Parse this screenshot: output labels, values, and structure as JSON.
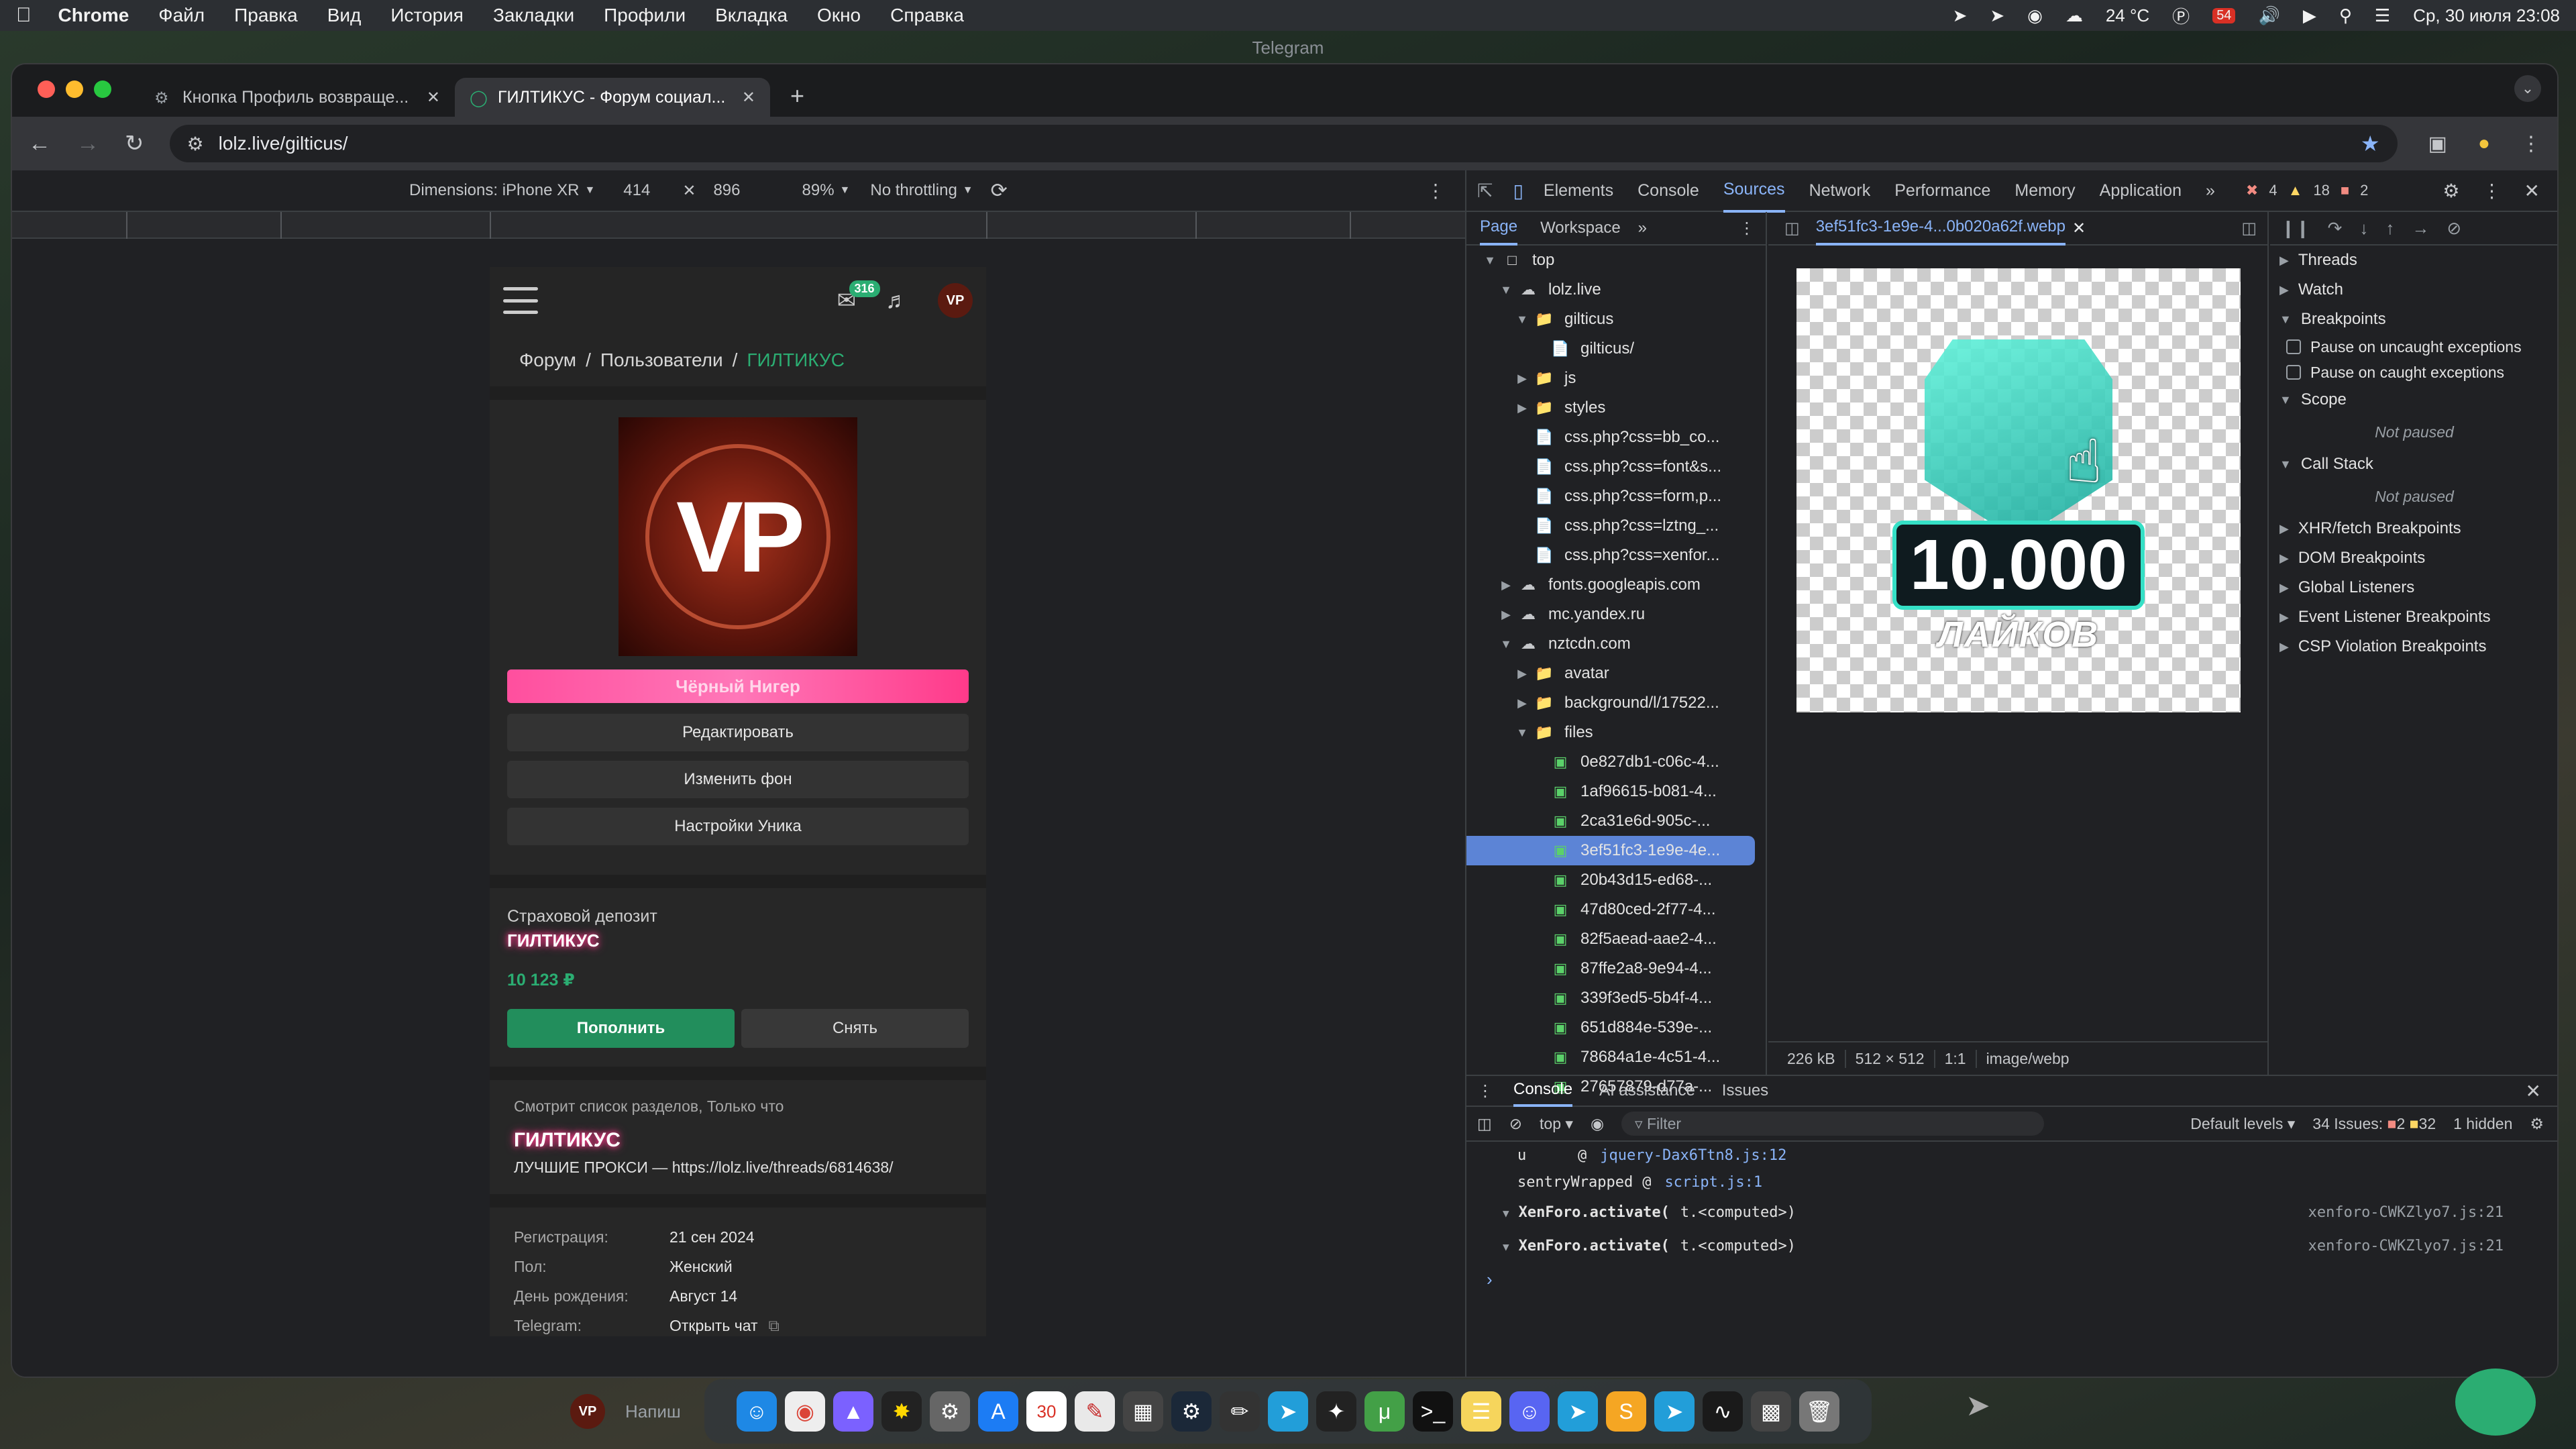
{
  "menubar": {
    "app": "Chrome",
    "menus": [
      "Файл",
      "Правка",
      "Вид",
      "История",
      "Закладки",
      "Профили",
      "Вкладка",
      "Окно",
      "Справка"
    ],
    "weather": "24 °C",
    "notif_count": "54",
    "datetime": "Ср, 30 июля  23:08"
  },
  "telegram_title": "Telegram",
  "browser": {
    "tabs": [
      {
        "label": "Кнопка Профиль возвраще..."
      },
      {
        "label": "ГИЛТИКУС - Форум социал..."
      }
    ],
    "url": "lolz.live/gilticus/"
  },
  "device_toolbar": {
    "dimensions": "Dimensions: iPhone XR",
    "width": "414",
    "height": "896",
    "zoom": "89%",
    "throttling": "No throttling"
  },
  "mobile": {
    "badge": "316",
    "avatar_small": "VP",
    "breadcrumb": [
      "Форум",
      "Пользователи",
      "ГИЛТИКУС"
    ],
    "avatar_text": "VP",
    "role": "Чёрный Нигер",
    "buttons": [
      "Редактировать",
      "Изменить фон",
      "Настройки Уника"
    ],
    "deposit_title": "Страховой депозит",
    "nick": "ГИЛТИКУС",
    "amount": "10 123 ₽",
    "deposit_btn": "Пополнить",
    "withdraw_btn": "Снять",
    "activity": "Смотрит список разделов, Только что",
    "status": "ЛУЧШИЕ ПРОКСИ — https://lolz.live/threads/6814638/",
    "info": [
      {
        "k": "Регистрация:",
        "v": "21 сен 2024"
      },
      {
        "k": "Пол:",
        "v": "Женский"
      },
      {
        "k": "День рождения:",
        "v": "Август 14"
      },
      {
        "k": "Telegram:",
        "v": "Открыть чат"
      }
    ]
  },
  "devtools": {
    "tabs": [
      "Elements",
      "Console",
      "Sources",
      "Network",
      "Performance",
      "Memory",
      "Application"
    ],
    "errors": "4",
    "warnings": "18",
    "issues": "2",
    "subtabs": [
      "Page",
      "Workspace"
    ],
    "tree": [
      {
        "d": 0,
        "a": "▼",
        "t": "top",
        "k": "frame"
      },
      {
        "d": 1,
        "a": "▼",
        "t": "lolz.live",
        "k": "cloud"
      },
      {
        "d": 2,
        "a": "▼",
        "t": "gilticus",
        "k": "folder"
      },
      {
        "d": 3,
        "a": "",
        "t": "gilticus/",
        "k": "file"
      },
      {
        "d": 2,
        "a": "▶",
        "t": "js",
        "k": "folder"
      },
      {
        "d": 2,
        "a": "▶",
        "t": "styles",
        "k": "folder"
      },
      {
        "d": 2,
        "a": "",
        "t": "css.php?css=bb_co...",
        "k": "file"
      },
      {
        "d": 2,
        "a": "",
        "t": "css.php?css=font&s...",
        "k": "file"
      },
      {
        "d": 2,
        "a": "",
        "t": "css.php?css=form,p...",
        "k": "file"
      },
      {
        "d": 2,
        "a": "",
        "t": "css.php?css=lztng_...",
        "k": "file"
      },
      {
        "d": 2,
        "a": "",
        "t": "css.php?css=xenfor...",
        "k": "file"
      },
      {
        "d": 1,
        "a": "▶",
        "t": "fonts.googleapis.com",
        "k": "cloud"
      },
      {
        "d": 1,
        "a": "▶",
        "t": "mc.yandex.ru",
        "k": "cloud"
      },
      {
        "d": 1,
        "a": "▼",
        "t": "nztcdn.com",
        "k": "cloud"
      },
      {
        "d": 2,
        "a": "▶",
        "t": "avatar",
        "k": "folder"
      },
      {
        "d": 2,
        "a": "▶",
        "t": "background/l/17522...",
        "k": "folder"
      },
      {
        "d": 2,
        "a": "▼",
        "t": "files",
        "k": "folder"
      },
      {
        "d": 3,
        "a": "",
        "t": "0e827db1-c06c-4...",
        "k": "img"
      },
      {
        "d": 3,
        "a": "",
        "t": "1af96615-b081-4...",
        "k": "img"
      },
      {
        "d": 3,
        "a": "",
        "t": "2ca31e6d-905c-...",
        "k": "img"
      },
      {
        "d": 3,
        "a": "",
        "t": "3ef51fc3-1e9e-4e...",
        "k": "img",
        "sel": true
      },
      {
        "d": 3,
        "a": "",
        "t": "20b43d15-ed68-...",
        "k": "img"
      },
      {
        "d": 3,
        "a": "",
        "t": "47d80ced-2f77-4...",
        "k": "img"
      },
      {
        "d": 3,
        "a": "",
        "t": "82f5aead-aae2-4...",
        "k": "img"
      },
      {
        "d": 3,
        "a": "",
        "t": "87ffe2a8-9e94-4...",
        "k": "img"
      },
      {
        "d": 3,
        "a": "",
        "t": "339f3ed5-5b4f-4...",
        "k": "img"
      },
      {
        "d": 3,
        "a": "",
        "t": "651d884e-539e-...",
        "k": "img"
      },
      {
        "d": 3,
        "a": "",
        "t": "78684a1e-4c51-4...",
        "k": "img"
      },
      {
        "d": 3,
        "a": "",
        "t": "27657879-d77a-...",
        "k": "img"
      }
    ],
    "file_tab": "3ef51fc3-1e9e-4...0b020a62f.webp",
    "preview_number": "10.000",
    "preview_text": "ЛАЙКОВ",
    "footer": [
      "226 kB",
      "512 × 512",
      "1:1",
      "image/webp"
    ],
    "debugger": {
      "sections_top": [
        "Threads",
        "Watch"
      ],
      "breakpoints": "Breakpoints",
      "checkboxes": [
        "Pause on uncaught exceptions",
        "Pause on caught exceptions"
      ],
      "scope": "Scope",
      "not_paused": "Not paused",
      "callstack": "Call Stack",
      "sections_bottom": [
        "XHR/fetch Breakpoints",
        "DOM Breakpoints",
        "Global Listeners",
        "Event Listener Breakpoints",
        "CSP Violation Breakpoints"
      ]
    },
    "drawer": {
      "tabs": [
        "Console",
        "AI assistance",
        "Issues"
      ],
      "context": "top",
      "filter": "Filter",
      "levels": "Default levels",
      "issues": "34 Issues:",
      "issues_err": "2",
      "issues_warn": "32",
      "hidden": "1 hidden",
      "lines": [
        {
          "a": "u",
          "b": "@",
          "c": "jquery-Dax6Ttn8.js:12"
        },
        {
          "a": "sentryWrapped",
          "b": "@",
          "c": "script.js:1"
        }
      ],
      "calls": [
        {
          "fn": "XenForo.activate(",
          "arg": "t.<computed>)",
          "src": "xenforo-CWKZlyo7.js:21"
        },
        {
          "fn": "XenForo.activate(",
          "arg": "t.<computed>)",
          "src": "xenforo-CWKZlyo7.js:21"
        }
      ]
    }
  },
  "tg_input": "Напиш",
  "dock_calendar": "30"
}
